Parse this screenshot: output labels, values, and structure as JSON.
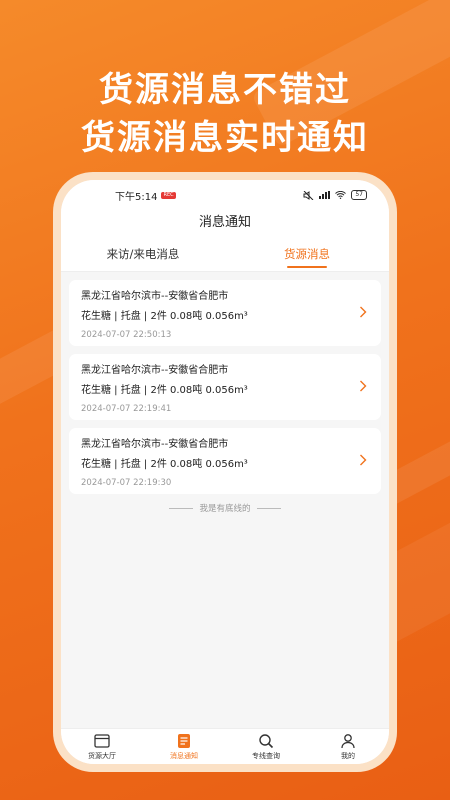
{
  "headline": {
    "line1": "货源消息不错过",
    "line2": "货源消息实时通知"
  },
  "statusbar": {
    "time": "下午5:14",
    "rec_badge": "REC",
    "battery": "57"
  },
  "nav": {
    "title": "消息通知"
  },
  "tabs": [
    {
      "label": "来访/来电消息",
      "active": false
    },
    {
      "label": "货源消息",
      "active": true
    }
  ],
  "messages": [
    {
      "route": "黑龙江省哈尔滨市--安徽省合肥市",
      "goods": "花生糖 | 托盘 | 2件 0.08吨 0.056m³",
      "time": "2024-07-07 22:50:13"
    },
    {
      "route": "黑龙江省哈尔滨市--安徽省合肥市",
      "goods": "花生糖 | 托盘 | 2件 0.08吨 0.056m³",
      "time": "2024-07-07 22:19:41"
    },
    {
      "route": "黑龙江省哈尔滨市--安徽省合肥市",
      "goods": "花生糖 | 托盘 | 2件 0.08吨 0.056m³",
      "time": "2024-07-07 22:19:30"
    }
  ],
  "list_end_text": "我是有底线的",
  "tabbar": [
    {
      "label": "货源大厅",
      "icon": "hall-icon",
      "active": false
    },
    {
      "label": "消息通知",
      "icon": "message-icon",
      "active": true
    },
    {
      "label": "专线查询",
      "icon": "search-icon",
      "active": false
    },
    {
      "label": "我的",
      "icon": "user-icon",
      "active": false
    }
  ],
  "colors": {
    "accent": "#f0721c",
    "background": "#f58a2a"
  }
}
